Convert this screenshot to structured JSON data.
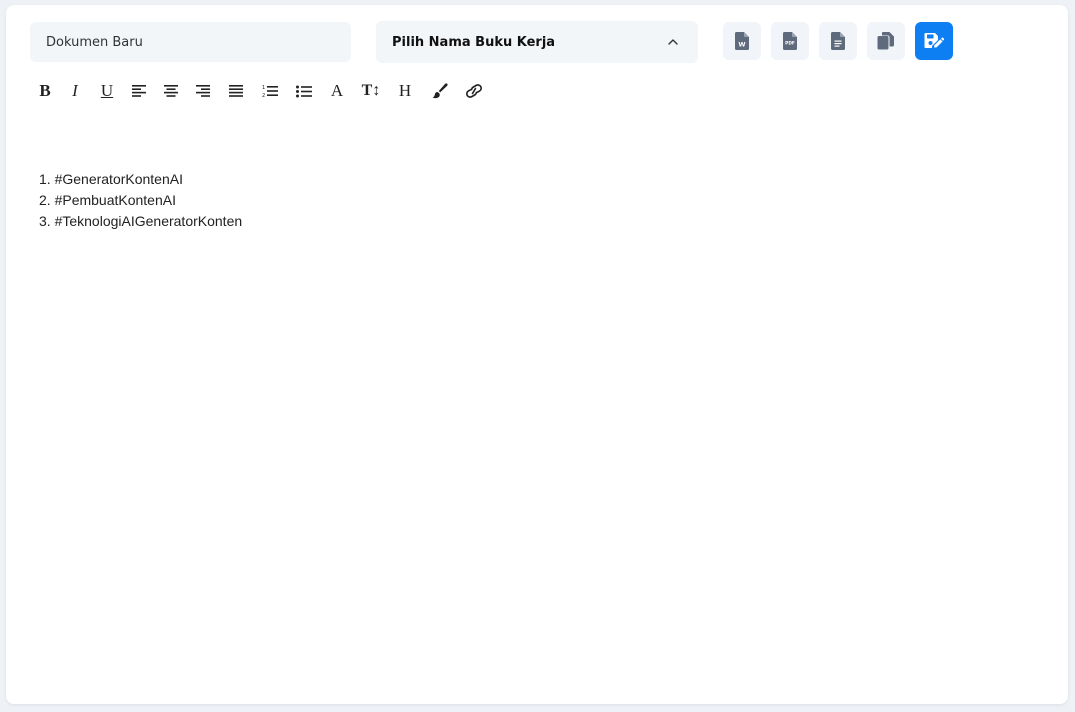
{
  "document": {
    "name_placeholder": "Dokumen Baru",
    "workbook_select": {
      "label": "Pilih Nama Buku Kerja"
    }
  },
  "actions": [
    {
      "icon": "word-file-icon",
      "badge": "W"
    },
    {
      "icon": "pdf-file-icon",
      "badge": "PDF"
    },
    {
      "icon": "text-file-icon"
    },
    {
      "icon": "copy-icon"
    },
    {
      "icon": "save-document-icon"
    }
  ],
  "toolbar": {
    "bold": "B",
    "italic": "I",
    "underline": "U",
    "font_color": "A",
    "font_size": "T↕",
    "heading": "H"
  },
  "editor": {
    "lines": [
      "1. #GeneratorKontenAI",
      "2. #PembuatKontenAI",
      "3. #TeknologiAIGeneratorKonten"
    ]
  },
  "colors": {
    "primary": "#0d7ff2",
    "input_bg": "#f3f6f9",
    "icon_gray": "#5f6b7d"
  }
}
